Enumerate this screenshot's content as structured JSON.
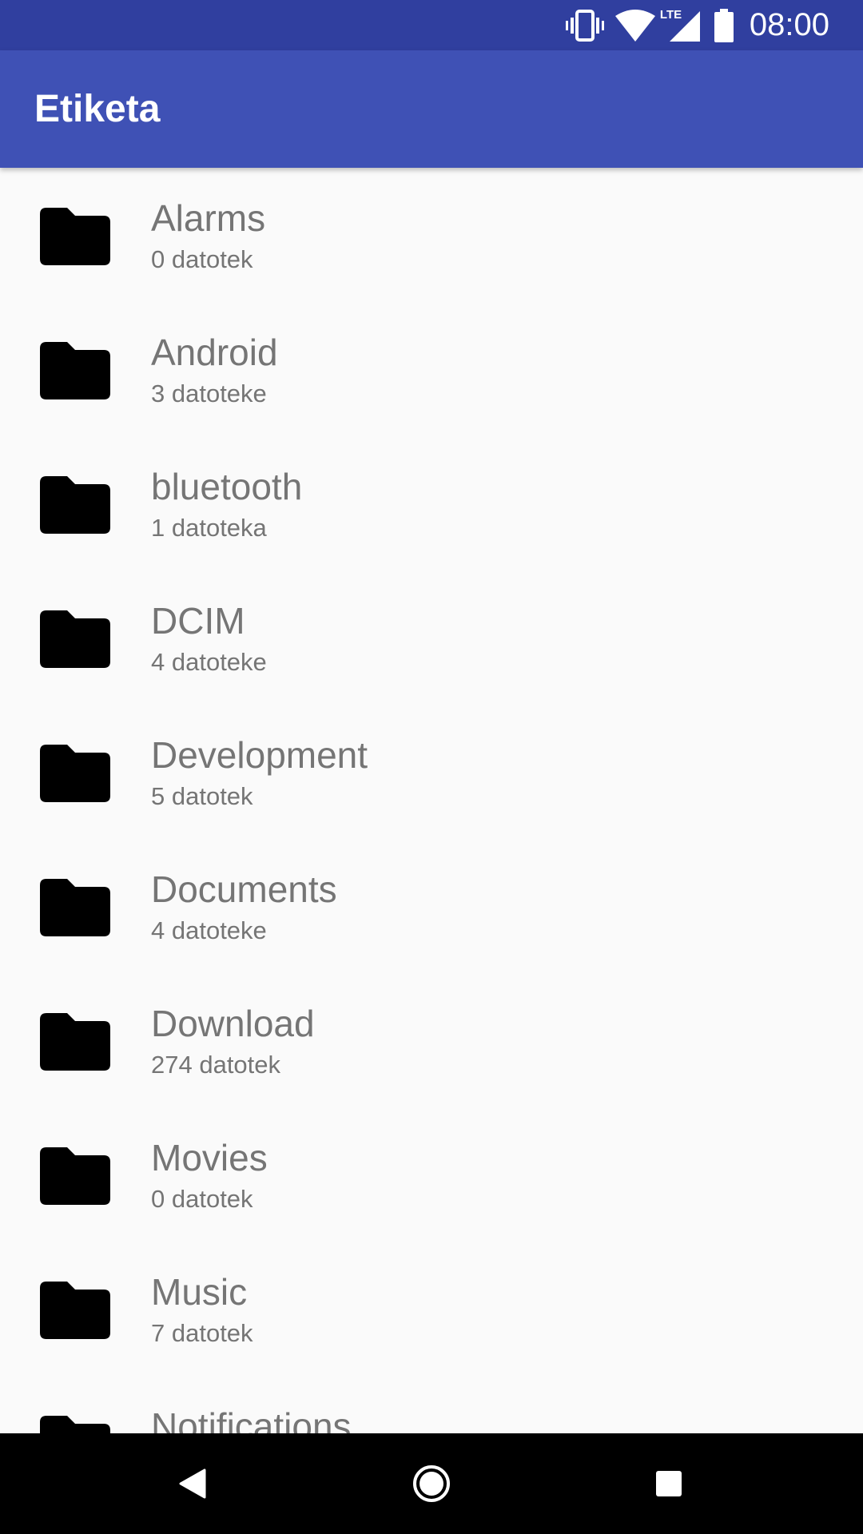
{
  "status_bar": {
    "time": "08:00",
    "icons": [
      "vibrate-icon",
      "wifi-icon",
      "lte-signal-icon",
      "battery-icon"
    ],
    "network_label": "LTE"
  },
  "app_bar": {
    "title": "Etiketa",
    "color": "#3f51b5"
  },
  "folders": [
    {
      "name": "Alarms",
      "count": "0 datotek"
    },
    {
      "name": "Android",
      "count": "3 datoteke"
    },
    {
      "name": "bluetooth",
      "count": "1 datoteka"
    },
    {
      "name": "DCIM",
      "count": "4 datoteke"
    },
    {
      "name": "Development",
      "count": "5 datotek"
    },
    {
      "name": "Documents",
      "count": "4 datoteke"
    },
    {
      "name": "Download",
      "count": "274 datotek"
    },
    {
      "name": "Movies",
      "count": "0 datotek"
    },
    {
      "name": "Music",
      "count": "7 datotek"
    },
    {
      "name": "Notifications",
      "count": ""
    }
  ],
  "nav_bar": {
    "buttons": [
      "back-icon",
      "home-icon",
      "recents-icon"
    ]
  }
}
